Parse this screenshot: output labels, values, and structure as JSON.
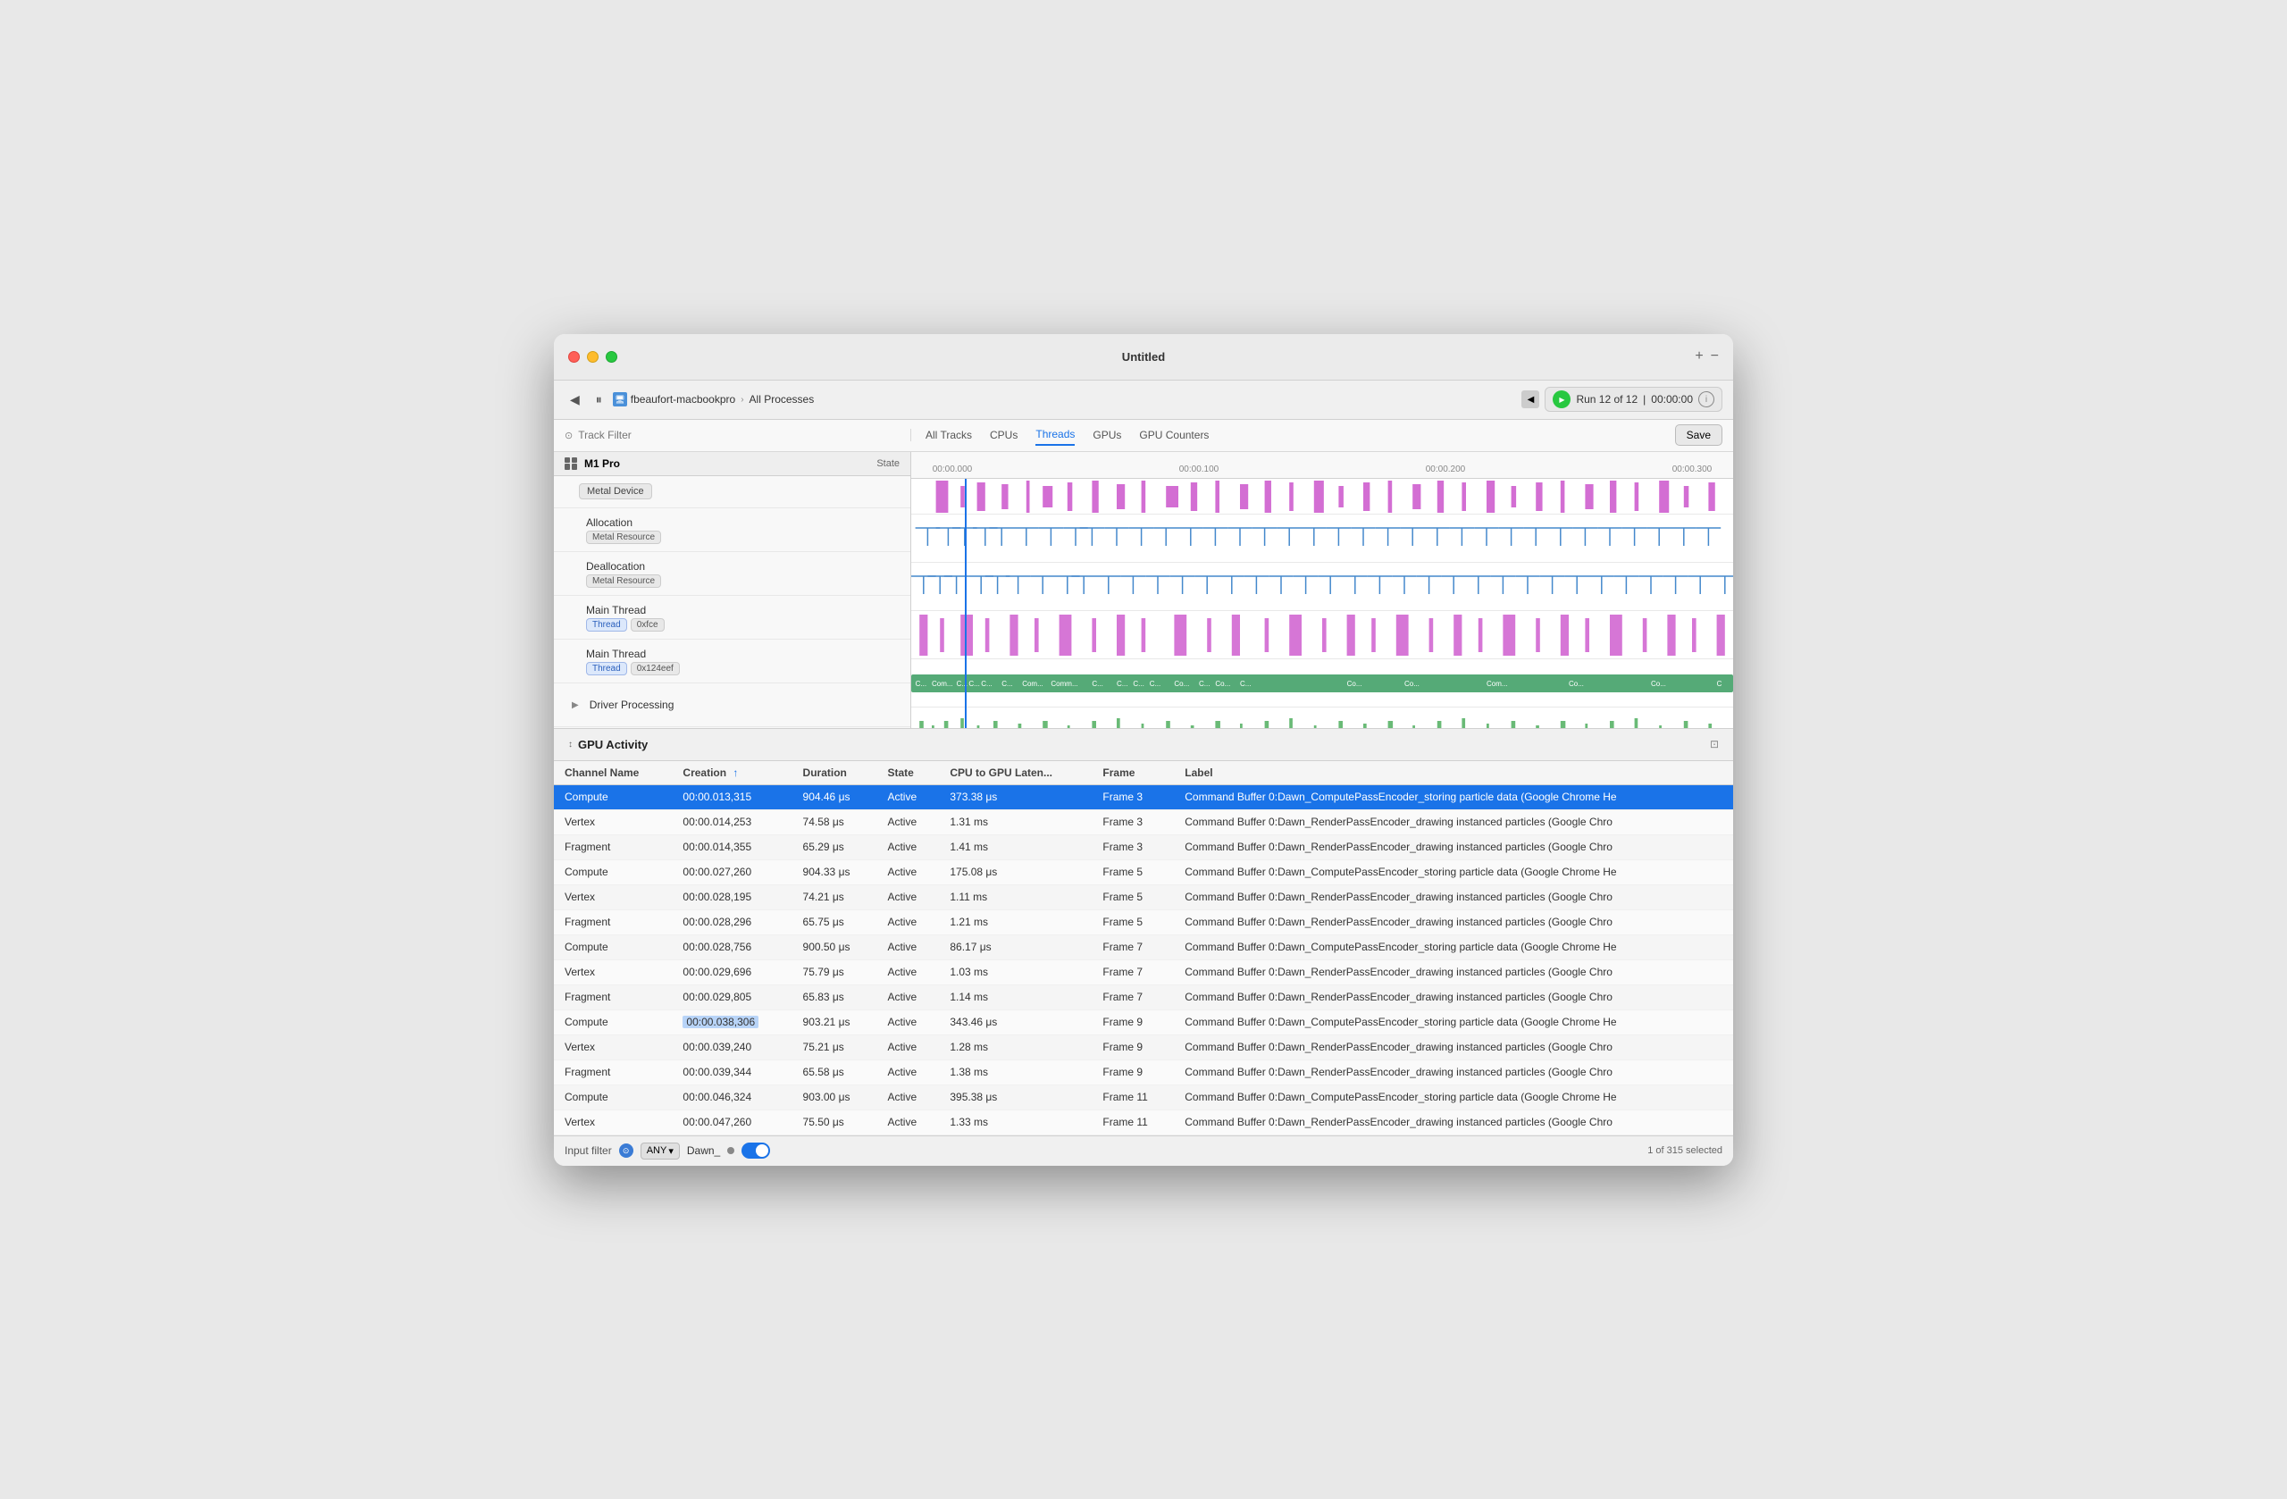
{
  "window": {
    "title": "Untitled"
  },
  "toolbar": {
    "device": "fbeaufort-macbookpro",
    "separator": "›",
    "process": "All Processes",
    "run_label": "Run 12 of 12",
    "time": "00:00:00",
    "plus_label": "+",
    "minus_label": "−",
    "save_label": "Save"
  },
  "tabs": {
    "filter_placeholder": "Track Filter",
    "items": [
      "All Tracks",
      "CPUs",
      "Threads",
      "GPUs",
      "GPU Counters"
    ]
  },
  "timeline": {
    "ruler": {
      "marks": [
        "00:00.000",
        "00:00.100",
        "00:00.200",
        "00:00.300"
      ]
    },
    "state_label": "State",
    "device_name": "M1 Pro",
    "device_tag": "Metal Device",
    "tracks": [
      {
        "name": "Allocation",
        "tag": "Metal Resource",
        "indent": 1
      },
      {
        "name": "Deallocation",
        "tag": "Metal Resource",
        "indent": 1
      },
      {
        "name": "Main Thread",
        "tag": "Thread",
        "tag2": "0xfce",
        "indent": 1
      },
      {
        "name": "Main Thread",
        "tag": "Thread",
        "tag2": "0x124eef",
        "indent": 1
      },
      {
        "name": "Driver Processing",
        "indent": 0,
        "expand": true
      }
    ]
  },
  "gpu_activity": {
    "title": "GPU Activity",
    "expand_icon": "↕",
    "columns": [
      {
        "id": "channel",
        "label": "Channel Name"
      },
      {
        "id": "creation",
        "label": "Creation",
        "sorted": true,
        "sort_dir": "asc"
      },
      {
        "id": "duration",
        "label": "Duration"
      },
      {
        "id": "state",
        "label": "State"
      },
      {
        "id": "cpu_gpu_lat",
        "label": "CPU to GPU Laten..."
      },
      {
        "id": "frame",
        "label": "Frame"
      },
      {
        "id": "label",
        "label": "Label"
      }
    ],
    "rows": [
      {
        "channel": "Compute",
        "creation": "00:00.013,315",
        "duration": "904.46 μs",
        "state": "Active",
        "cpu_gpu_lat": "373.38 μs",
        "frame": "Frame 3",
        "label": "Command Buffer 0:Dawn_ComputePassEncoder_storing particle data   (Google Chrome He",
        "selected": true,
        "creation_highlight": false
      },
      {
        "channel": "Vertex",
        "creation": "00:00.014,253",
        "duration": "74.58 μs",
        "state": "Active",
        "cpu_gpu_lat": "1.31 ms",
        "frame": "Frame 3",
        "label": "Command Buffer 0:Dawn_RenderPassEncoder_drawing instanced particles   (Google Chro"
      },
      {
        "channel": "Fragment",
        "creation": "00:00.014,355",
        "duration": "65.29 μs",
        "state": "Active",
        "cpu_gpu_lat": "1.41 ms",
        "frame": "Frame 3",
        "label": "Command Buffer 0:Dawn_RenderPassEncoder_drawing instanced particles   (Google Chro"
      },
      {
        "channel": "Compute",
        "creation": "00:00.027,260",
        "duration": "904.33 μs",
        "state": "Active",
        "cpu_gpu_lat": "175.08 μs",
        "frame": "Frame 5",
        "label": "Command Buffer 0:Dawn_ComputePassEncoder_storing particle data   (Google Chrome He"
      },
      {
        "channel": "Vertex",
        "creation": "00:00.028,195",
        "duration": "74.21 μs",
        "state": "Active",
        "cpu_gpu_lat": "1.11 ms",
        "frame": "Frame 5",
        "label": "Command Buffer 0:Dawn_RenderPassEncoder_drawing instanced particles   (Google Chro"
      },
      {
        "channel": "Fragment",
        "creation": "00:00.028,296",
        "duration": "65.75 μs",
        "state": "Active",
        "cpu_gpu_lat": "1.21 ms",
        "frame": "Frame 5",
        "label": "Command Buffer 0:Dawn_RenderPassEncoder_drawing instanced particles   (Google Chro"
      },
      {
        "channel": "Compute",
        "creation": "00:00.028,756",
        "duration": "900.50 μs",
        "state": "Active",
        "cpu_gpu_lat": "86.17 μs",
        "frame": "Frame 7",
        "label": "Command Buffer 0:Dawn_ComputePassEncoder_storing particle data   (Google Chrome He"
      },
      {
        "channel": "Vertex",
        "creation": "00:00.029,696",
        "duration": "75.79 μs",
        "state": "Active",
        "cpu_gpu_lat": "1.03 ms",
        "frame": "Frame 7",
        "label": "Command Buffer 0:Dawn_RenderPassEncoder_drawing instanced particles   (Google Chro"
      },
      {
        "channel": "Fragment",
        "creation": "00:00.029,805",
        "duration": "65.83 μs",
        "state": "Active",
        "cpu_gpu_lat": "1.14 ms",
        "frame": "Frame 7",
        "label": "Command Buffer 0:Dawn_RenderPassEncoder_drawing instanced particles   (Google Chro"
      },
      {
        "channel": "Compute",
        "creation": "00:00.038,306",
        "duration": "903.21 μs",
        "state": "Active",
        "cpu_gpu_lat": "343.46 μs",
        "frame": "Frame 9",
        "label": "Command Buffer 0:Dawn_ComputePassEncoder_storing particle data   (Google Chrome He",
        "creation_highlight": true
      },
      {
        "channel": "Vertex",
        "creation": "00:00.039,240",
        "duration": "75.21 μs",
        "state": "Active",
        "cpu_gpu_lat": "1.28 ms",
        "frame": "Frame 9",
        "label": "Command Buffer 0:Dawn_RenderPassEncoder_drawing instanced particles   (Google Chro"
      },
      {
        "channel": "Fragment",
        "creation": "00:00.039,344",
        "duration": "65.58 μs",
        "state": "Active",
        "cpu_gpu_lat": "1.38 ms",
        "frame": "Frame 9",
        "label": "Command Buffer 0:Dawn_RenderPassEncoder_drawing instanced particles   (Google Chro"
      },
      {
        "channel": "Compute",
        "creation": "00:00.046,324",
        "duration": "903.00 μs",
        "state": "Active",
        "cpu_gpu_lat": "395.38 μs",
        "frame": "Frame 11",
        "label": "Command Buffer 0:Dawn_ComputePassEncoder_storing particle data   (Google Chrome He"
      },
      {
        "channel": "Vertex",
        "creation": "00:00.047,260",
        "duration": "75.50 μs",
        "state": "Active",
        "cpu_gpu_lat": "1.33 ms",
        "frame": "Frame 11",
        "label": "Command Buffer 0:Dawn_RenderPassEncoder_drawing instanced particles   (Google Chro"
      }
    ]
  },
  "input_filter": {
    "label": "Input filter",
    "condition": "ANY",
    "value": "Dawn_",
    "selection_info": "1 of 315 selected"
  }
}
